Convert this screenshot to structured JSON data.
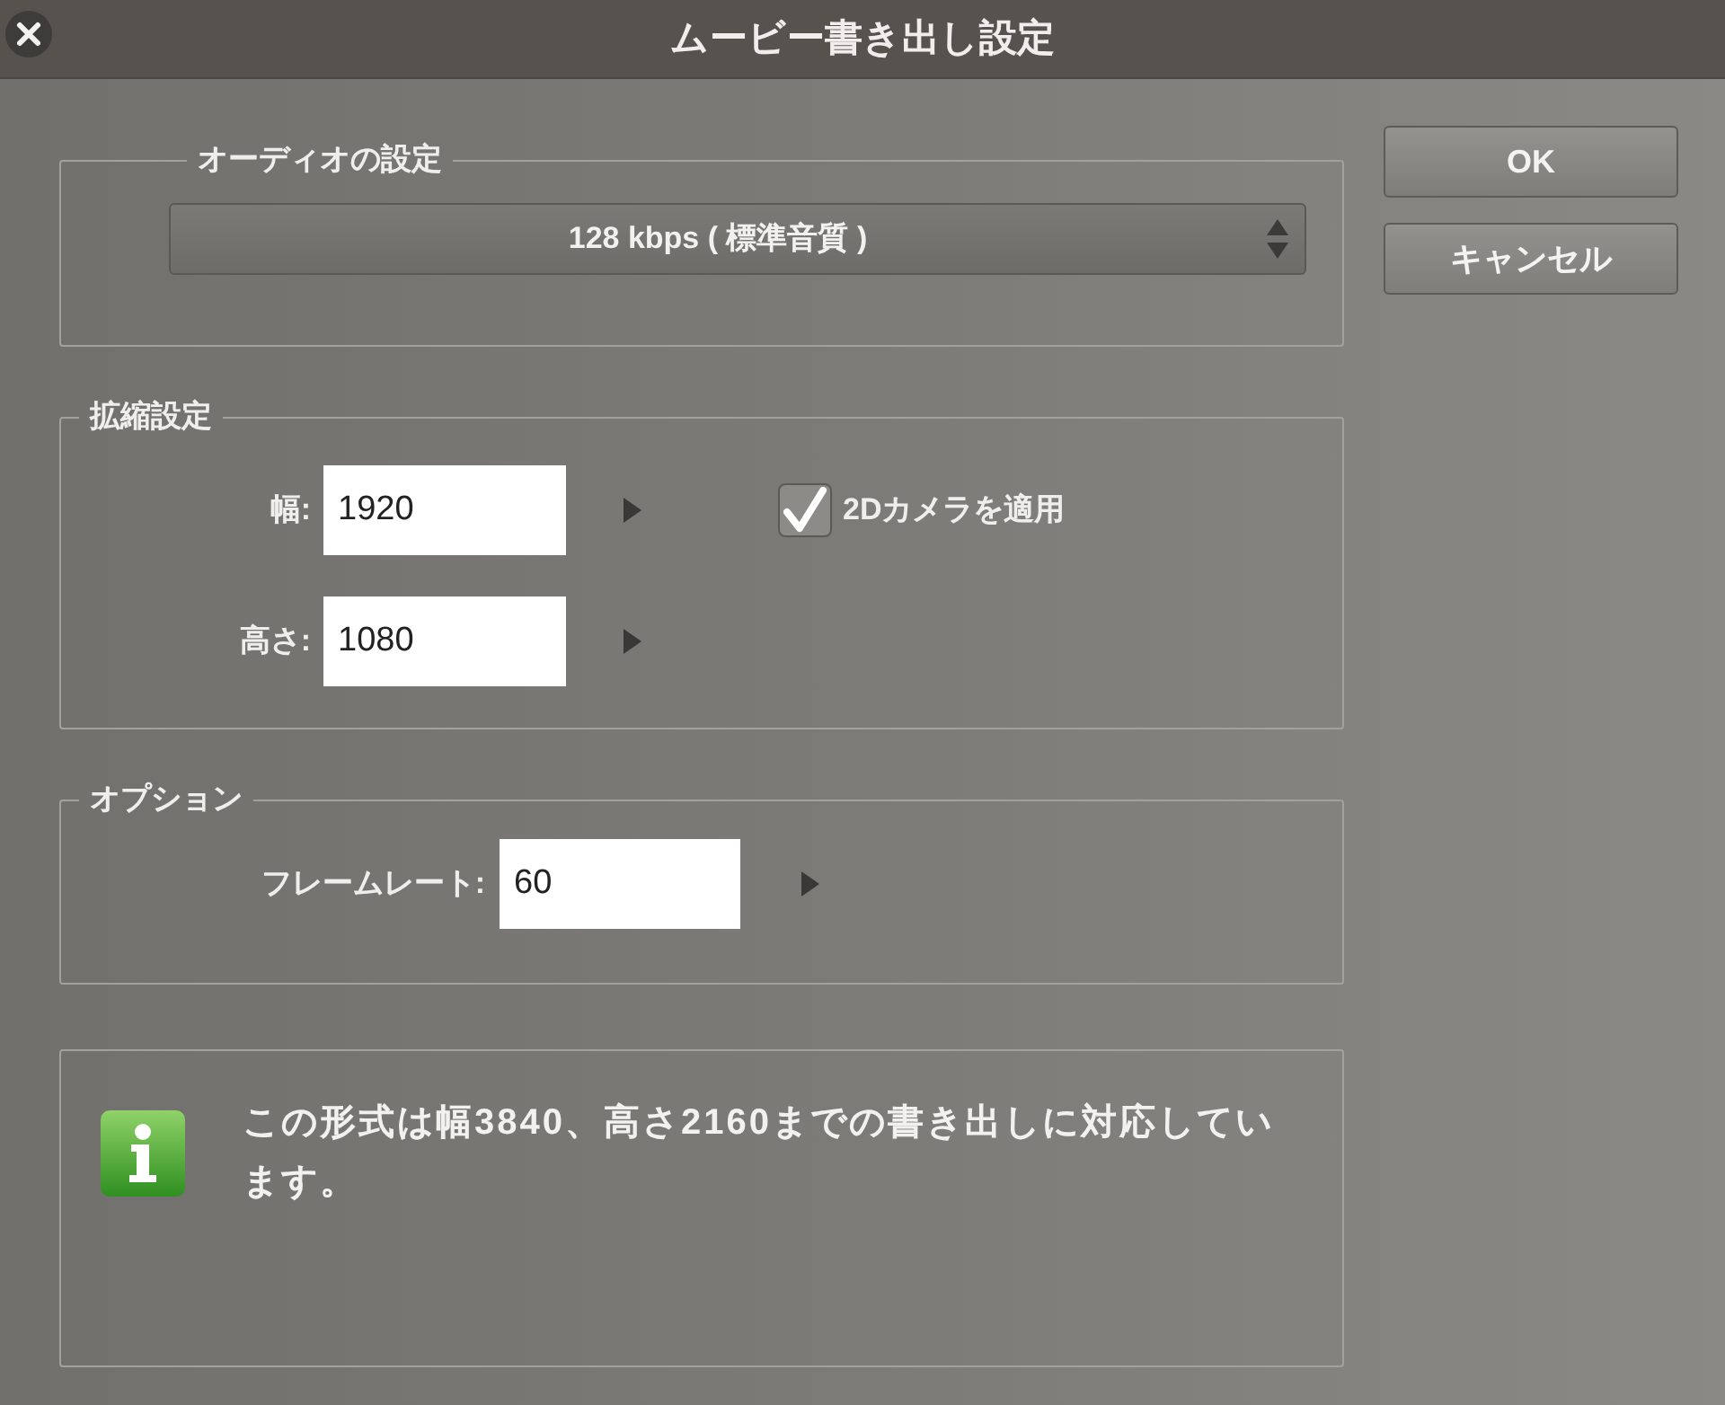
{
  "window": {
    "title": "ムービー書き出し設定"
  },
  "audio": {
    "label": "オーディオの設定",
    "dropdown": {
      "value": "128 kbps ( 標準音質 )"
    }
  },
  "scale": {
    "label": "拡縮設定",
    "fields": [
      {
        "label": "幅:",
        "value": "1920"
      },
      {
        "label": "高さ:",
        "value": "1080"
      }
    ],
    "checkbox": {
      "label": "2Dカメラを適用",
      "checked": true
    }
  },
  "options": {
    "label": "オプション",
    "fields": [
      {
        "label": "フレームレート:",
        "value": "60"
      }
    ]
  },
  "info": {
    "message": "この形式は幅3840、高さ2160までの書き出しに対応しています。"
  },
  "buttons": [
    "OK",
    "キャンセル"
  ]
}
